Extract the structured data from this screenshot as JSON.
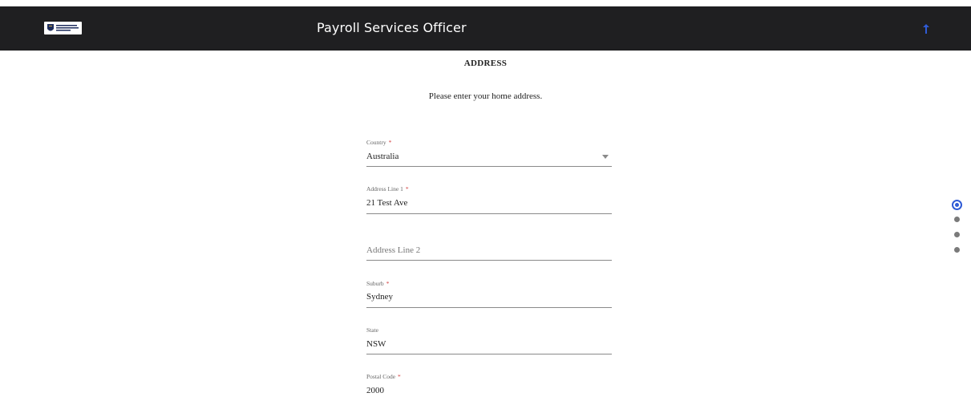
{
  "header": {
    "logo_icon": "university-logo",
    "title": "Payroll Services Officer",
    "scroll_up_icon": "arrow-up-icon",
    "accent_color": "#2f5bd6"
  },
  "section": {
    "heading": "ADDRESS",
    "instructions": "Please enter your home address."
  },
  "form": {
    "country": {
      "label": "Country",
      "required": "*",
      "value": "Australia"
    },
    "address_line_1": {
      "label": "Address Line 1",
      "required": "*",
      "value": "21 Test Ave"
    },
    "address_line_2": {
      "placeholder": "Address Line 2"
    },
    "suburb": {
      "label": "Suburb",
      "required": "*",
      "value": "Sydney"
    },
    "state": {
      "label": "State",
      "value": "NSW"
    },
    "postal_code": {
      "label": "Postal Code",
      "required": "*",
      "value": "2000"
    }
  },
  "page_nav": {
    "total_steps": 4,
    "active_step": 1
  }
}
